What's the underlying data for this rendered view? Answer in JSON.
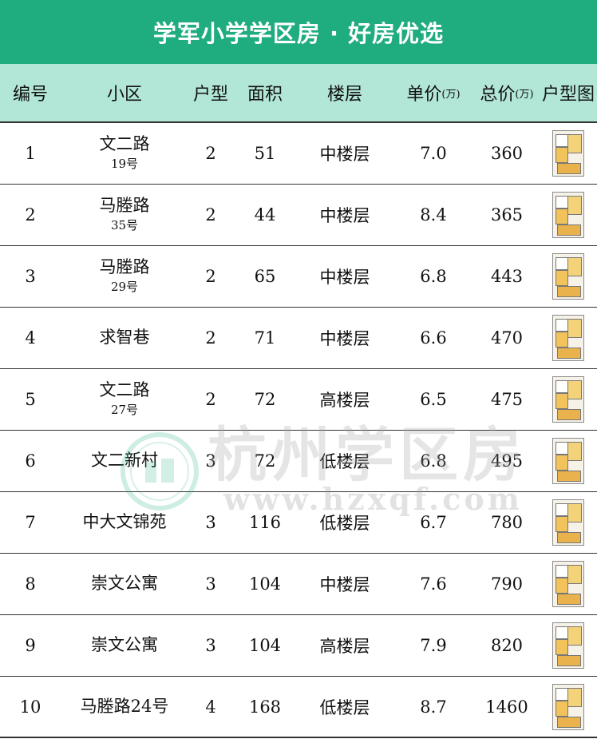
{
  "title": "学军小学学区房 · 好房优选",
  "colors": {
    "title_bg": "#1fac7f",
    "header_bg": "#b2e6d6"
  },
  "headers": {
    "no": "编号",
    "name": "小区",
    "type": "户型",
    "area": "面积",
    "floor": "楼层",
    "unit_price": "单价",
    "unit_price_unit": "(万)",
    "total_price": "总价",
    "total_price_unit": "(万)",
    "plan": "户型图"
  },
  "rows": [
    {
      "no": "1",
      "name": "文二路",
      "sub": "19号",
      "type": "2",
      "area": "51",
      "floor": "中楼层",
      "unit_price": "7.0",
      "total_price": "360"
    },
    {
      "no": "2",
      "name": "马塍路",
      "sub": "35号",
      "type": "2",
      "area": "44",
      "floor": "中楼层",
      "unit_price": "8.4",
      "total_price": "365"
    },
    {
      "no": "3",
      "name": "马塍路",
      "sub": "29号",
      "type": "2",
      "area": "65",
      "floor": "中楼层",
      "unit_price": "6.8",
      "total_price": "443"
    },
    {
      "no": "4",
      "name": "求智巷",
      "sub": "",
      "type": "2",
      "area": "71",
      "floor": "中楼层",
      "unit_price": "6.6",
      "total_price": "470"
    },
    {
      "no": "5",
      "name": "文二路",
      "sub": "27号",
      "type": "2",
      "area": "72",
      "floor": "高楼层",
      "unit_price": "6.5",
      "total_price": "475"
    },
    {
      "no": "6",
      "name": "文二新村",
      "sub": "",
      "type": "3",
      "area": "72",
      "floor": "低楼层",
      "unit_price": "6.8",
      "total_price": "495"
    },
    {
      "no": "7",
      "name": "中大文锦苑",
      "sub": "",
      "type": "3",
      "area": "116",
      "floor": "低楼层",
      "unit_price": "6.7",
      "total_price": "780"
    },
    {
      "no": "8",
      "name": "崇文公寓",
      "sub": "",
      "type": "3",
      "area": "104",
      "floor": "中楼层",
      "unit_price": "7.6",
      "total_price": "790"
    },
    {
      "no": "9",
      "name": "崇文公寓",
      "sub": "",
      "type": "3",
      "area": "104",
      "floor": "高楼层",
      "unit_price": "7.9",
      "total_price": "820"
    },
    {
      "no": "10",
      "name": "马塍路24号",
      "sub": "",
      "type": "4",
      "area": "168",
      "floor": "低楼层",
      "unit_price": "8.7",
      "total_price": "1460"
    }
  ],
  "watermark": {
    "text": "杭州学区房",
    "url": "www.hzxqf.com"
  }
}
